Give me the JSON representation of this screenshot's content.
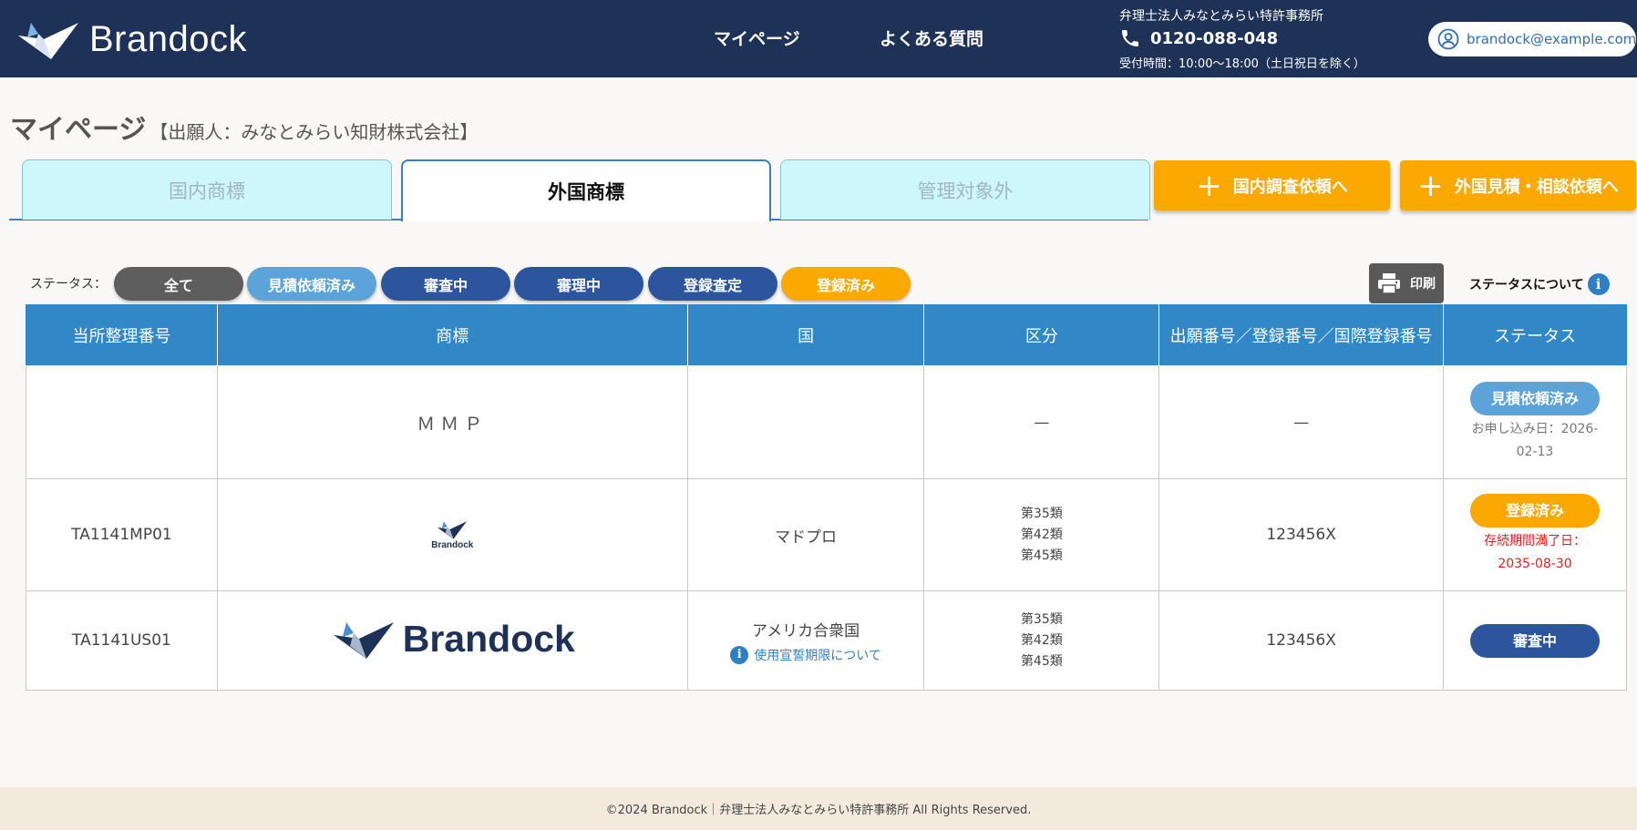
{
  "header": {
    "logo_text": "Brandock",
    "nav": {
      "mypage": "マイページ",
      "faq": "よくある質問"
    },
    "office_name": "弁理士法人みなとみらい特許事務所",
    "phone": "0120-088-048",
    "hours": "受付時間：10:00〜18:00（土日祝日を除く）",
    "user_email": "brandock@example.com"
  },
  "page": {
    "title": "マイページ",
    "applicant": "【出願人：みなとみらい知財株式会社】"
  },
  "tabs": [
    {
      "label": "国内商標"
    },
    {
      "label": "外国商標"
    },
    {
      "label": "管理対象外"
    }
  ],
  "actions": {
    "domestic": "国内調査依頼へ",
    "foreign": "外国見積・相談依頼へ"
  },
  "filter": {
    "label": "ステータス：",
    "options": [
      "全て",
      "見積依頼済み",
      "審査中",
      "審理中",
      "登録査定",
      "登録済み"
    ]
  },
  "print_label": "印刷",
  "status_about": "ステータスについて",
  "colors": {
    "header_bg": "#1e3157",
    "table_header": "#3288c7",
    "accent_orange": "#fba800",
    "status_blue": "#2c559e",
    "status_lightblue": "#5ba3d8",
    "tab_inactive": "#cef7fc"
  },
  "table": {
    "columns": [
      "当所整理番号",
      "商標",
      "国",
      "区分",
      "出願番号／登録番号／国際登録番号",
      "ステータス"
    ],
    "rows": [
      {
        "ref": "",
        "mark_text": "ＭＭＰ",
        "country": "",
        "classes": "—",
        "number": "—",
        "status": "見積依頼済み",
        "status_note": "お申し込み日：2026-02-13"
      },
      {
        "ref": "TA1141MP01",
        "mark_logo": "Brandock",
        "country": "マドプロ",
        "classes": [
          "第35類",
          "第42類",
          "第45類"
        ],
        "number": "123456X",
        "status": "登録済み",
        "status_note_line1": "存続期間満了日：",
        "status_note_line2": "2035-08-30"
      },
      {
        "ref": "TA1141US01",
        "mark_logo": "Brandock",
        "country": "アメリカ合衆国",
        "country_link": "使用宣誓期限について",
        "classes": [
          "第35類",
          "第42類",
          "第45類"
        ],
        "number": "123456X",
        "status": "審査中"
      }
    ]
  },
  "footer": "©2024 Brandock｜弁理士法人みなとみらい特許事務所 All Rights Reserved."
}
